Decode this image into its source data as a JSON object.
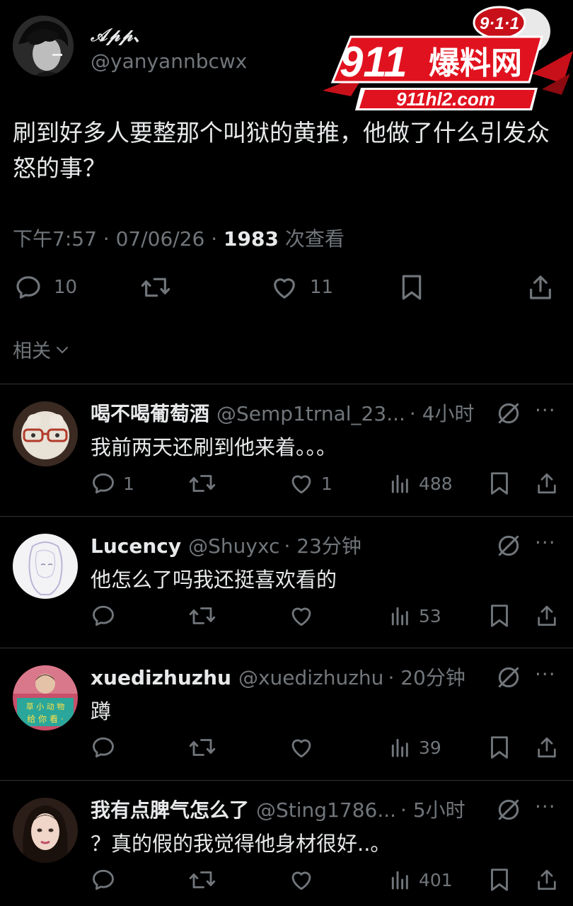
{
  "post": {
    "author_name": "𝒜𝓅𝓅、",
    "author_handle": "@yanyannbcwx",
    "text": "刷到好多人要整那个叫狱的黄推，他做了什么引发众怒的事？",
    "time": "下午7:57 · 07/06/26 · ",
    "views_count": "1983",
    "views_label": " 次查看",
    "replies": "10",
    "likes": "11"
  },
  "watermark": {
    "badge": "9·1·1",
    "title_number": "911",
    "title_text": "爆料网",
    "url": "911hl2.com"
  },
  "related_label": "相关",
  "replies": [
    {
      "name": "喝不喝葡萄酒",
      "handle": "@Semp1trnal_23...",
      "time": "· 4小时",
      "text": "我前两天还刷到他来着。。。",
      "reply_count": "1",
      "retweet_count": "",
      "like_count": "1",
      "view_count": "488"
    },
    {
      "name": "Lucency",
      "handle": "@Shuyxc",
      "time": "· 23分钟",
      "text": "他怎么了吗我还挺喜欢看的",
      "reply_count": "",
      "retweet_count": "",
      "like_count": "",
      "view_count": "53"
    },
    {
      "name": "xuedizhuzhu",
      "handle": "@xuedizhuzhu",
      "time": "· 20分钟",
      "text": "蹲",
      "reply_count": "",
      "retweet_count": "",
      "like_count": "",
      "view_count": "39"
    },
    {
      "name": "我有点脾气怎么了",
      "handle": "@Sting1786...",
      "time": "· 5小时",
      "text": "？真的假的我觉得他身材很好..。",
      "reply_count": "",
      "retweet_count": "",
      "like_count": "",
      "view_count": "401"
    }
  ],
  "colors": {
    "background": "#000000",
    "text": "#e7e9ea",
    "muted": "#71767b",
    "divider": "#2f3336",
    "logo_red": "#e1121f"
  }
}
